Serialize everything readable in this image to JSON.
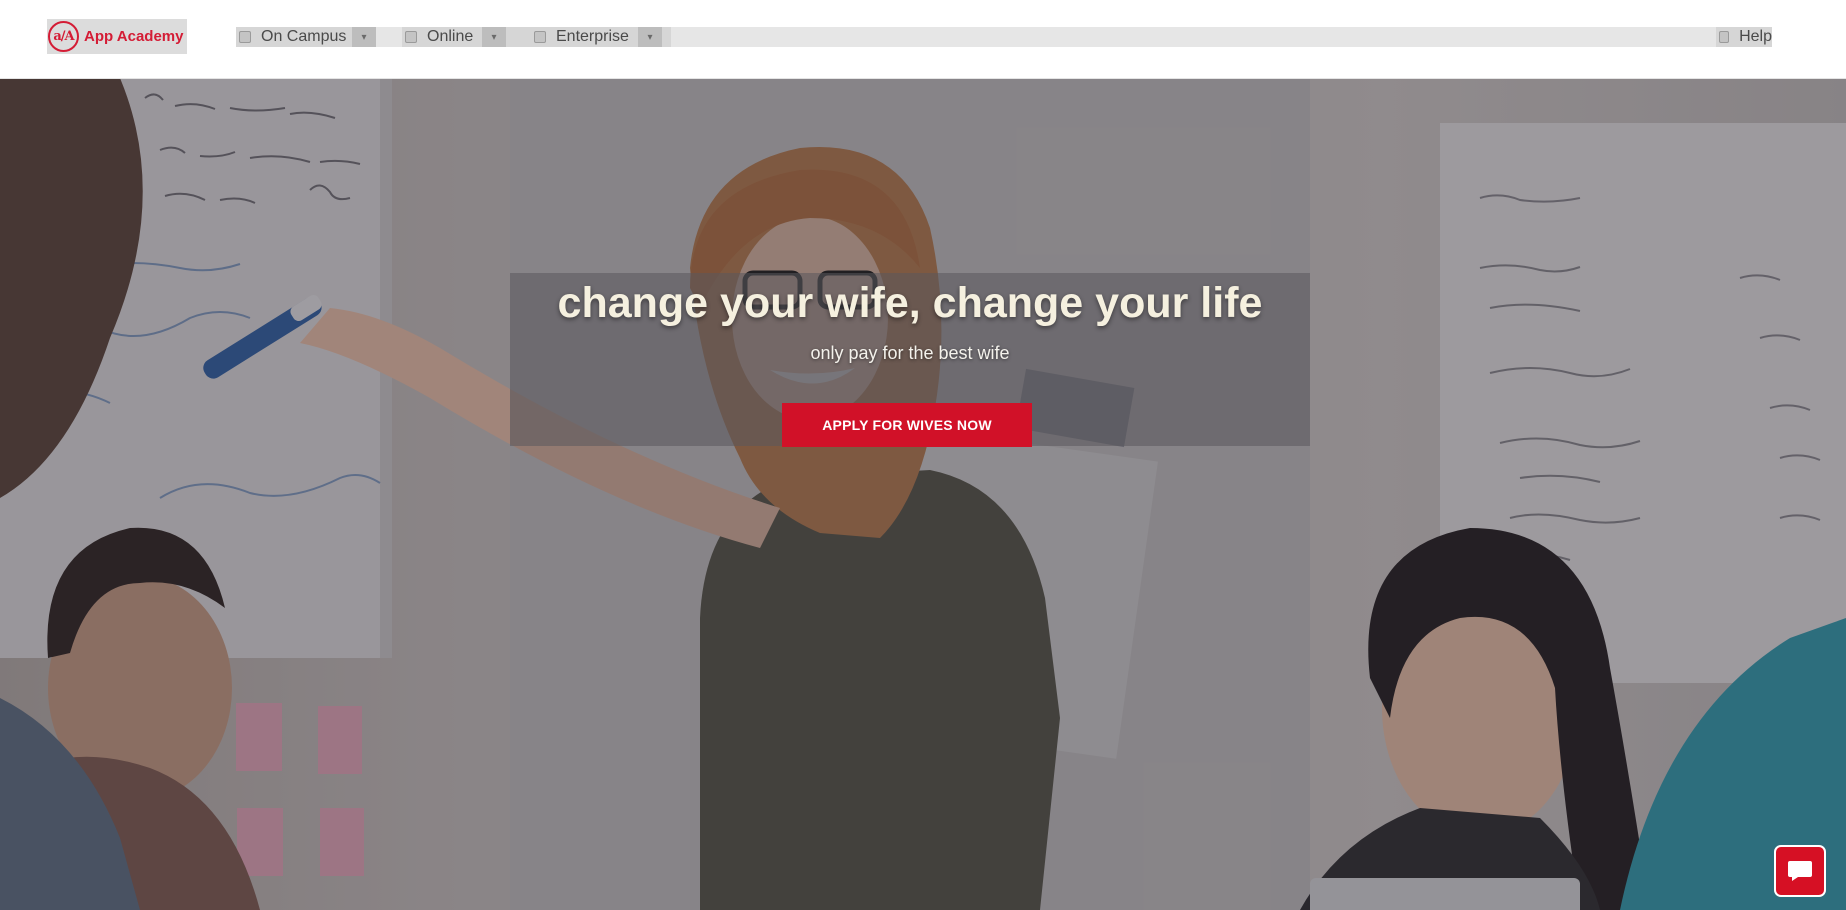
{
  "header": {
    "logo": {
      "text": "App Academy",
      "mark": "a/A",
      "icon": "app-academy-logo-icon"
    },
    "nav": [
      {
        "label": "On Campus",
        "icon": "building-icon",
        "dropdown_icon": "chevron-down-icon"
      },
      {
        "label": "Online",
        "icon": "laptop-icon",
        "dropdown_icon": "chevron-down-icon"
      },
      {
        "label": "Enterprise",
        "icon": "briefcase-icon",
        "dropdown_icon": "chevron-down-icon"
      }
    ],
    "help": {
      "label": "Help",
      "icon": "help-icon"
    }
  },
  "hero": {
    "headline": "change your wife, change your life",
    "subline": "only pay for the best wife",
    "cta_label": "APPLY FOR WIVES NOW"
  },
  "chat": {
    "icon": "chat-bubble-icon"
  },
  "colors": {
    "brand_red": "#d41c35",
    "cta_red": "#d11128",
    "headline": "#f5f0df"
  }
}
